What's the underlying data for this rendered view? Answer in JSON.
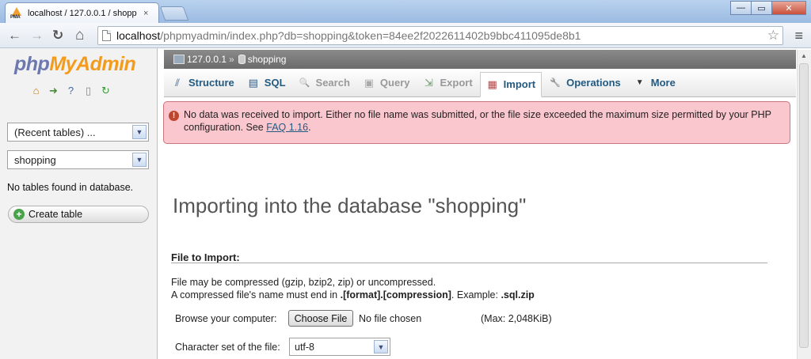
{
  "browser": {
    "tab_title": "localhost / 127.0.0.1 / shopp",
    "tab_close": "×",
    "window_buttons": {
      "minimize": "—",
      "maximize": "▭",
      "close": "✕"
    },
    "url_host": "localhost",
    "url_rest": "/phpmyadmin/index.php?db=shopping&token=84ee2f2022611402b9bbc411095de8b1",
    "nav": {
      "back": "←",
      "forward": "→",
      "reload": "↻",
      "home": "⌂"
    },
    "star": "☆",
    "menu": "≡"
  },
  "sidebar": {
    "logo_php": "php",
    "logo_myadmin": "MyAdmin",
    "recent_tables": "(Recent tables) ...",
    "database_select": "shopping",
    "no_tables_text": "No tables found in database.",
    "create_table_label": "Create table"
  },
  "breadcrumb": {
    "server": "127.0.0.1",
    "separator": "»",
    "database": "shopping"
  },
  "tabs": [
    {
      "label": "Structure",
      "icon": "structure-icon",
      "glyph": "⫽"
    },
    {
      "label": "SQL",
      "icon": "sql-icon",
      "glyph": "▤"
    },
    {
      "label": "Search",
      "icon": "search-icon",
      "glyph": "🔍"
    },
    {
      "label": "Query",
      "icon": "query-icon",
      "glyph": "▣"
    },
    {
      "label": "Export",
      "icon": "export-icon",
      "glyph": "⇲"
    },
    {
      "label": "Import",
      "icon": "import-icon",
      "glyph": "▦"
    },
    {
      "label": "Operations",
      "icon": "wrench-icon",
      "glyph": "🔧"
    },
    {
      "label": "More",
      "icon": "chevron-down-icon",
      "glyph": "▼"
    }
  ],
  "error": {
    "message": "No data was received to import. Either no file name was submitted, or the file size exceeded the maximum size permitted by your PHP configuration. See ",
    "link": "FAQ 1.16",
    "suffix": "."
  },
  "main": {
    "title": "Importing into the database \"shopping\"",
    "file_to_import": "File to Import:",
    "desc_line1": "File may be compressed (gzip, bzip2, zip) or uncompressed.",
    "desc_line2_prefix": "A compressed file's name must end in ",
    "desc_line2_format": ".[format].[compression]",
    "desc_line2_mid": ". Example: ",
    "desc_line2_example": ".sql.zip",
    "browse_label": "Browse your computer:",
    "choose_file": "Choose File",
    "no_file": "No file chosen",
    "max_size": "(Max: 2,048KiB)",
    "charset_label": "Character set of the file:",
    "charset_value": "utf-8"
  },
  "colors": {
    "error_bg": "#fbc7cf",
    "link": "#235a81",
    "logo_php": "#6c78af",
    "logo_myadmin": "#f29b1c"
  }
}
